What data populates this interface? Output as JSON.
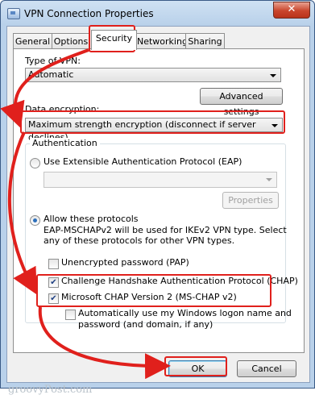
{
  "window": {
    "title": "VPN Connection Properties",
    "close_label": "✕"
  },
  "tabs": [
    "General",
    "Options",
    "Security",
    "Networking",
    "Sharing"
  ],
  "active_tab": "Security",
  "security": {
    "type_label": "Type of VPN:",
    "type_value": "Automatic",
    "advanced_button": "Advanced settings",
    "encryption_label": "Data encryption:",
    "encryption_value": "Maximum strength encryption (disconnect if server declines)",
    "auth_group_label": "Authentication",
    "eap_radio_label": "Use Extensible Authentication Protocol (EAP)",
    "eap_combo_value": "",
    "properties_button": "Properties",
    "allow_radio_label": "Allow these protocols",
    "allow_desc_line1": "EAP-MSCHAPv2 will be used for IKEv2 VPN type. Select",
    "allow_desc_line2": "any of these protocols for other VPN types.",
    "pap_label": "Unencrypted password (PAP)",
    "chap_label": "Challenge Handshake Authentication Protocol (CHAP)",
    "mschap_label": "Microsoft CHAP Version 2 (MS-CHAP v2)",
    "autologon_line1": "Automatically use my Windows logon name and",
    "autologon_line2": "password (and domain, if any)",
    "pap_checked": false,
    "chap_checked": true,
    "mschap_checked": true,
    "autologon_checked": false,
    "selected_radio": "allow"
  },
  "footer": {
    "ok_button": "OK",
    "cancel_button": "Cancel"
  },
  "watermark": "groovyPost.com",
  "colors": {
    "highlight_red": "#e0201c",
    "title_bar": "#b9d1ea",
    "close_red": "#c9452c"
  }
}
